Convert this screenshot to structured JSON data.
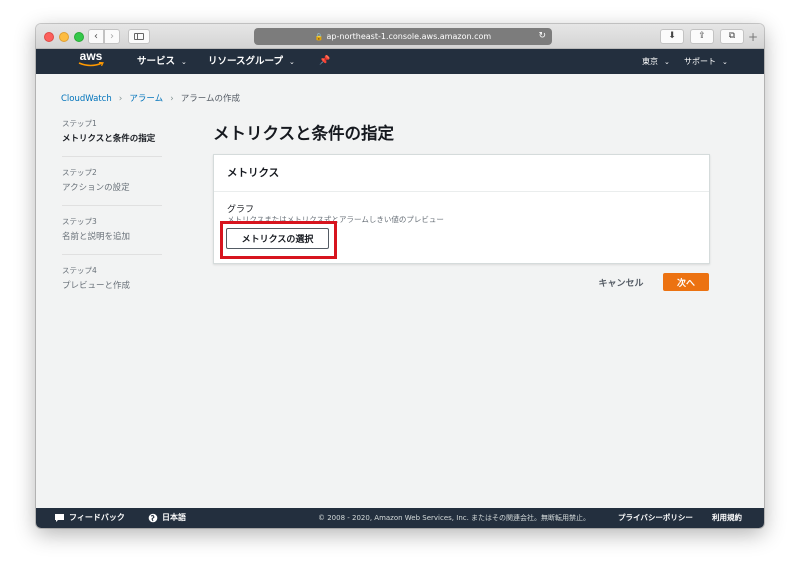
{
  "browser": {
    "url": "ap-northeast-1.console.aws.amazon.com",
    "back_label": "‹",
    "forward_label": "›",
    "download_label": "⬇",
    "share_label": "⇪",
    "tabs_label": "⧉",
    "new_tab_label": "+"
  },
  "aws_nav": {
    "logo_text": "aws",
    "services_label": "サービス",
    "resource_groups_label": "リソースグループ",
    "pin_icon": "pin-icon",
    "region_label": "東京",
    "support_label": "サポート"
  },
  "breadcrumb": {
    "items": [
      "CloudWatch",
      "アラーム",
      "アラームの作成"
    ]
  },
  "steps": [
    {
      "number": "ステップ1",
      "name": "メトリクスと条件の指定"
    },
    {
      "number": "ステップ2",
      "name": "アクションの設定"
    },
    {
      "number": "ステップ3",
      "name": "名前と説明を追加"
    },
    {
      "number": "ステップ4",
      "name": "プレビューと作成"
    }
  ],
  "main": {
    "page_title": "メトリクスと条件の指定",
    "panel_title": "メトリクス",
    "graph_label": "グラフ",
    "graph_description": "メトリクスまたはメトリクス式とアラームしきい値のプレビュー",
    "select_metric_label": "メトリクスの選択",
    "cancel_label": "キャンセル",
    "next_label": "次へ"
  },
  "footer": {
    "feedback_label": "フィードバック",
    "language_label": "日本語",
    "copyright": "© 2008 - 2020, Amazon Web Services, Inc. またはその関連会社。無断転用禁止。",
    "privacy_label": "プライバシーポリシー",
    "terms_label": "利用規約"
  },
  "colors": {
    "aws_nav_bg": "#232f3e",
    "primary_button": "#ec7211",
    "link": "#0073bb",
    "highlight": "#d7141e"
  }
}
